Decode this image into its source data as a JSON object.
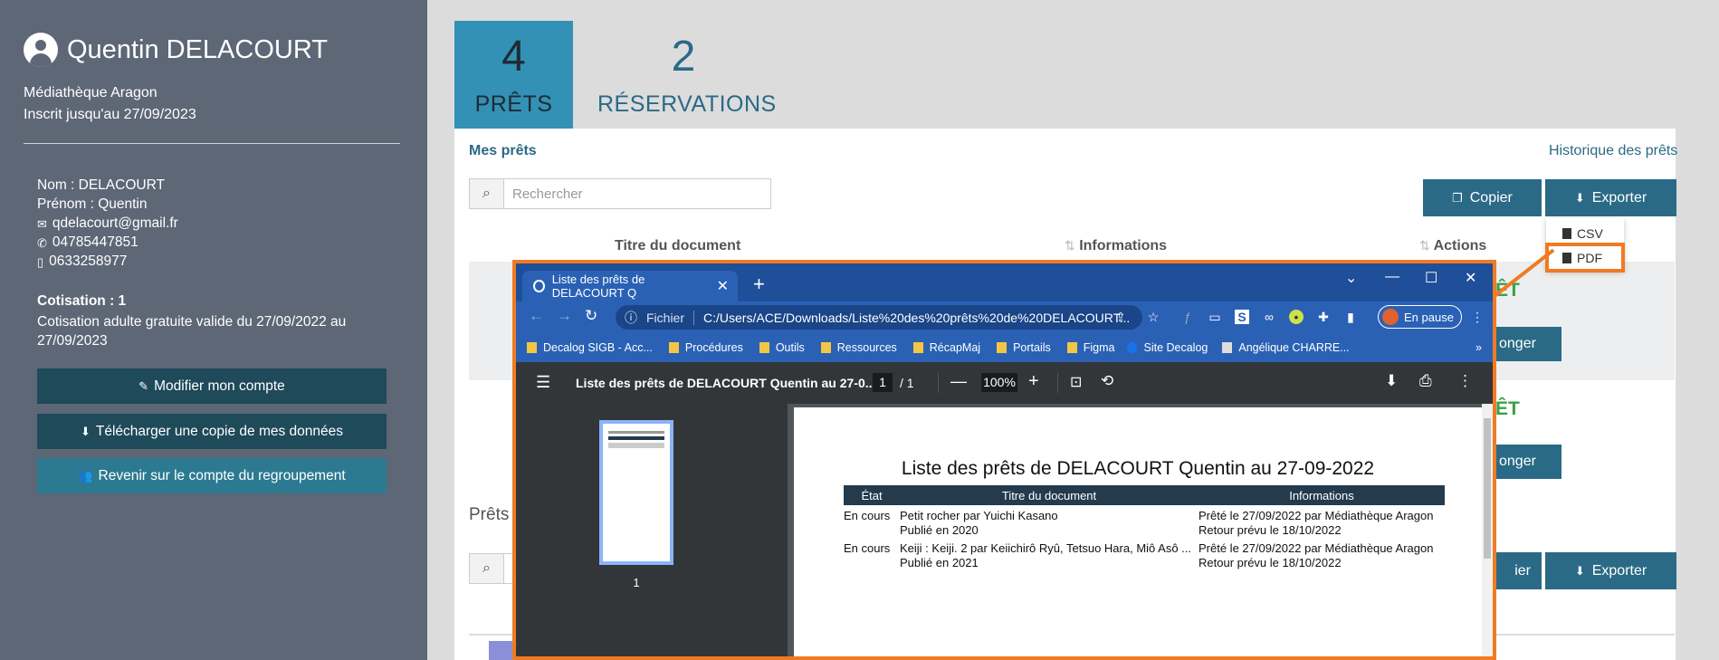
{
  "sidebar": {
    "user_name": "Quentin DELACOURT",
    "library": "Médiathèque Aragon",
    "registered": "Inscrit jusqu'au 27/09/2023",
    "nom": "Nom : DELACOURT",
    "prenom": "Prénom : Quentin",
    "email": "qdelacourt@gmail.fr",
    "phone": "04785447851",
    "mobile": "0633258977",
    "cotisation_title": "Cotisation : 1",
    "cotisation_text": "Cotisation adulte gratuite valide du 27/09/2022 au 27/09/2023",
    "buttons": {
      "modify": "Modifier mon compte",
      "download": "Télécharger une copie de mes données",
      "regroup": "Revenir sur le compte du regroupement"
    }
  },
  "tabs": [
    {
      "count": "4",
      "label": "PRÊTS"
    },
    {
      "count": "2",
      "label": "RÉSERVATIONS"
    }
  ],
  "loans": {
    "title": "Mes prêts",
    "history_link": "Historique des prêts",
    "search_placeholder": "Rechercher",
    "copy_button": "Copier",
    "export_button": "Exporter",
    "columns": [
      "Titre du document",
      "Informations",
      "Actions"
    ],
    "dropdown": [
      "CSV",
      "PDF"
    ],
    "row_status_fragment": "ÊT",
    "prolong_fragment": "onger",
    "section_fragment": "Prêts",
    "copy_fragment": "ier",
    "export_button_2": "Exporter"
  },
  "browser": {
    "tab_title": "Liste des prêts de DELACOURT Q",
    "url_protocol": "Fichier",
    "url": "C:/Users/ACE/Downloads/Liste%20des%20prêts%20de%20DELACOURT...",
    "paused_label": "En pause",
    "bookmarks": [
      "Decalog SIGB - Acc...",
      "Procédures",
      "Outils",
      "Ressources",
      "RécapMaj",
      "Portails",
      "Figma",
      "Site Decalog",
      "Angélique CHARRE..."
    ],
    "pdf_title": "Liste des prêts de DELACOURT Quentin au 27-0...",
    "page_current": "1",
    "page_total": "/  1",
    "zoom": "100%",
    "thumb_page": "1"
  },
  "pdf_document": {
    "title": "Liste des prêts de DELACOURT Quentin au 27-09-2022",
    "headers": [
      "État",
      "Titre du document",
      "Informations"
    ],
    "rows": [
      {
        "etat": "En cours",
        "titre": "Petit rocher par Yuichi Kasano",
        "titre2": "Publié en 2020",
        "info": "Prêté le 27/09/2022 par Médiathèque Aragon",
        "info2": "Retour prévu le 18/10/2022"
      },
      {
        "etat": "En cours",
        "titre": "Keiji : Keiji. 2 par Keiichirô Ryû, Tetsuo Hara, Miô Asô ...",
        "titre2": "Publié en 2021",
        "info": "Prêté le 27/09/2022 par Médiathèque Aragon",
        "info2": "Retour prévu le 18/10/2022"
      }
    ]
  },
  "colors": {
    "sidebar": "#5d6776",
    "accent": "#2a6a86",
    "highlight": "#f07b22",
    "status_green": "#3aa14a"
  }
}
